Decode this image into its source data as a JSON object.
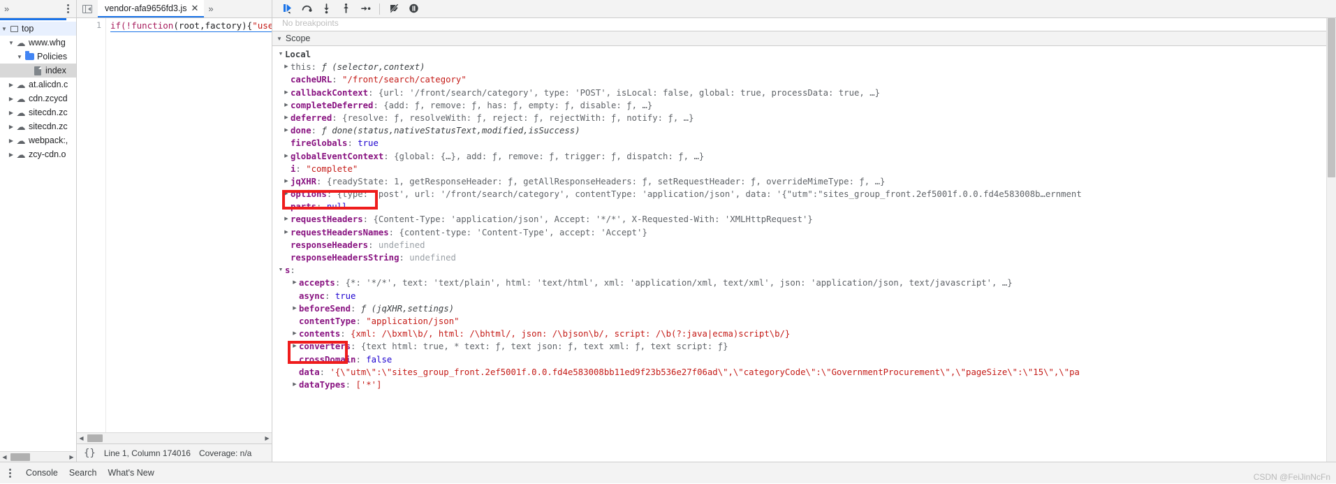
{
  "navigator": {
    "overflow_icon": "chevron-double-right",
    "menu_icon": "kebab-menu",
    "tree": [
      {
        "label": "top",
        "icon": "frame-icon",
        "twisty": "open",
        "indent": 0,
        "state": "highlight"
      },
      {
        "label": "www.whg",
        "icon": "cloud-icon",
        "twisty": "open",
        "indent": 1,
        "state": "normal"
      },
      {
        "label": "Policies",
        "icon": "folder-icon",
        "twisty": "open",
        "indent": 2,
        "state": "normal"
      },
      {
        "label": "index",
        "icon": "file-icon",
        "twisty": "blank",
        "indent": 3,
        "state": "selected"
      },
      {
        "label": "at.alicdn.c",
        "icon": "cloud-icon",
        "twisty": "closed",
        "indent": 1,
        "state": "normal"
      },
      {
        "label": "cdn.zcycd",
        "icon": "cloud-icon",
        "twisty": "closed",
        "indent": 1,
        "state": "normal"
      },
      {
        "label": "sitecdn.zc",
        "icon": "cloud-icon",
        "twisty": "closed",
        "indent": 1,
        "state": "normal"
      },
      {
        "label": "sitecdn.zc",
        "icon": "cloud-icon",
        "twisty": "closed",
        "indent": 1,
        "state": "normal"
      },
      {
        "label": "webpack:,",
        "icon": "cloud-icon",
        "twisty": "closed",
        "indent": 1,
        "state": "normal"
      },
      {
        "label": "zcy-cdn.o",
        "icon": "cloud-icon",
        "twisty": "closed",
        "indent": 1,
        "state": "normal"
      }
    ]
  },
  "editor": {
    "panel_toggle_icon": "show-navigator-icon",
    "tab_label": "vendor-afa9656fd3.js",
    "tab_close_icon": "close-icon",
    "tabs_overflow_icon": "chevron-double-right",
    "gutter_line": "1",
    "code": {
      "seg1": "if(!",
      "seg2": "function",
      "seg3": "(root,factory){",
      "seg4": "\"use"
    },
    "status": {
      "pretty_print_icon": "{}",
      "position": "Line 1, Column 174016",
      "coverage": "Coverage: n/a"
    }
  },
  "debugger": {
    "buttons": [
      {
        "name": "resume-script-execution",
        "icon": "resume-icon"
      },
      {
        "name": "step-over-next-function-call",
        "icon": "step-over-icon"
      },
      {
        "name": "step-into-next-function-call",
        "icon": "step-into-icon"
      },
      {
        "name": "step-out-of-current-function",
        "icon": "step-out-icon"
      },
      {
        "name": "step",
        "icon": "step-icon"
      },
      {
        "name": "deactivate-breakpoints",
        "icon": "deactivate-breakpoints-icon"
      },
      {
        "name": "pause-on-exceptions",
        "icon": "pause-on-exceptions-icon"
      }
    ],
    "ghost_text": "No breakpoints",
    "scope_header": "Scope",
    "scope_name": "Local",
    "rows": [
      {
        "id": "r-local",
        "indent": 0,
        "twisty": "open",
        "key": "Local",
        "key_style": "scope",
        "value": ""
      },
      {
        "id": "r-this",
        "indent": 1,
        "twisty": "closed",
        "key": "this",
        "key_style": "plain",
        "value_html": "fn:ƒ (selector,context)"
      },
      {
        "id": "r-cacheurl",
        "indent": 1,
        "twisty": "none",
        "key": "cacheURL",
        "key_style": "bold",
        "value_html": "str:\"/front/search/category\""
      },
      {
        "id": "r-callbackcontext",
        "indent": 1,
        "twisty": "closed",
        "key": "callbackContext",
        "key_style": "bold",
        "value_html": "obj"
      },
      {
        "id": "r-completedeferred",
        "indent": 1,
        "twisty": "closed",
        "key": "completeDeferred",
        "key_style": "bold",
        "value_html": "obj"
      },
      {
        "id": "r-deferred",
        "indent": 1,
        "twisty": "closed",
        "key": "deferred",
        "key_style": "bold",
        "value_html": "obj"
      },
      {
        "id": "r-done",
        "indent": 1,
        "twisty": "closed",
        "key": "done",
        "key_style": "bold",
        "value_html": "fn"
      },
      {
        "id": "r-fireglobals",
        "indent": 1,
        "twisty": "none",
        "key": "fireGlobals",
        "key_style": "bold",
        "value_html": "bool"
      },
      {
        "id": "r-globaleventcontext",
        "indent": 1,
        "twisty": "closed",
        "key": "globalEventContext",
        "key_style": "bold",
        "value_html": "obj"
      },
      {
        "id": "r-i",
        "indent": 1,
        "twisty": "none",
        "key": "i",
        "key_style": "bold",
        "value_html": "str"
      },
      {
        "id": "r-jqxhr",
        "indent": 1,
        "twisty": "closed",
        "key": "jqXHR",
        "key_style": "bold",
        "value_html": "obj"
      },
      {
        "id": "r-options",
        "indent": 1,
        "twisty": "closed",
        "key": "options",
        "key_style": "bold",
        "value_html": "obj"
      },
      {
        "id": "r-parts",
        "indent": 1,
        "twisty": "none",
        "key": "parts",
        "key_style": "bold",
        "value_html": "null"
      },
      {
        "id": "r-requestheaders",
        "indent": 1,
        "twisty": "closed",
        "key": "requestHeaders",
        "key_style": "bold",
        "value_html": "obj"
      },
      {
        "id": "r-requestheadersnames",
        "indent": 1,
        "twisty": "closed",
        "key": "requestHeadersNames",
        "key_style": "bold",
        "value_html": "obj"
      },
      {
        "id": "r-responseheaders",
        "indent": 1,
        "twisty": "none",
        "key": "responseHeaders",
        "key_style": "bold",
        "value_html": "undefined"
      },
      {
        "id": "r-responseheadersstring",
        "indent": 1,
        "twisty": "none",
        "key": "responseHeadersString",
        "key_style": "bold",
        "value_html": "undefined"
      },
      {
        "id": "r-s",
        "indent": 1,
        "twisty": "open",
        "key": "s",
        "key_style": "bold",
        "value_html": ""
      },
      {
        "id": "r-accepts",
        "indent": 2,
        "twisty": "closed",
        "key": "accepts",
        "key_style": "bold",
        "value_html": "obj"
      },
      {
        "id": "r-async",
        "indent": 2,
        "twisty": "none",
        "key": "async",
        "key_style": "bold",
        "value_html": "bool"
      },
      {
        "id": "r-beforesend",
        "indent": 2,
        "twisty": "closed",
        "key": "beforeSend",
        "key_style": "bold",
        "value_html": "fn"
      },
      {
        "id": "r-contenttype",
        "indent": 2,
        "twisty": "none",
        "key": "contentType",
        "key_style": "bold",
        "value_html": "str"
      },
      {
        "id": "r-contents",
        "indent": 2,
        "twisty": "closed",
        "key": "contents",
        "key_style": "bold",
        "value_html": "obj"
      },
      {
        "id": "r-converters",
        "indent": 2,
        "twisty": "closed",
        "key": "converters",
        "key_style": "bold",
        "value_html": "obj"
      },
      {
        "id": "r-crossdomain",
        "indent": 2,
        "twisty": "none",
        "key": "crossDomain",
        "key_style": "bold",
        "value_html": "bool"
      },
      {
        "id": "r-data",
        "indent": 2,
        "twisty": "none",
        "key": "data",
        "key_style": "bold",
        "value_html": "str"
      },
      {
        "id": "r-datatypes",
        "indent": 2,
        "twisty": "closed",
        "key": "dataTypes",
        "key_style": "bold",
        "value_html": "arr"
      }
    ],
    "text": {
      "local": "Local",
      "this_key": "this",
      "this_val": "ƒ (selector,context)",
      "cacheurl_key": "cacheURL",
      "cacheurl_val": "\"/front/search/category\"",
      "callbackcontext_key": "callbackContext",
      "callbackcontext_val": "{url: '/front/search/category', type: 'POST', isLocal: false, global: true, processData: true, …}",
      "completedeferred_key": "completeDeferred",
      "completedeferred_val": "{add: ƒ, remove: ƒ, has: ƒ, empty: ƒ, disable: ƒ, …}",
      "deferred_key": "deferred",
      "deferred_val": "{resolve: ƒ, resolveWith: ƒ, reject: ƒ, rejectWith: ƒ, notify: ƒ, …}",
      "done_key": "done",
      "done_val": "ƒ done(status,nativeStatusText,modified,isSuccess)",
      "fireglobals_key": "fireGlobals",
      "fireglobals_val": "true",
      "globaleventcontext_key": "globalEventContext",
      "globaleventcontext_val": "{global: {…}, add: ƒ, remove: ƒ, trigger: ƒ, dispatch: ƒ, …}",
      "i_key": "i",
      "i_val": "\"complete\"",
      "jqxhr_key": "jqXHR",
      "jqxhr_val": "{readyState: 1, getResponseHeader: ƒ, getAllResponseHeaders: ƒ, setRequestHeader: ƒ, overrideMimeType: ƒ, …}",
      "options_key": "options",
      "options_val": "{type: 'post', url: '/front/search/category', contentType: 'application/json', data: '{\"utm\":\"sites_group_front.2ef5001f.0.0.fd4e583008b…ernment",
      "parts_key": "parts",
      "parts_val": "null",
      "requestheaders_key": "requestHeaders",
      "requestheaders_val": "{Content-Type: 'application/json', Accept: '*/*', X-Requested-With: 'XMLHttpRequest'}",
      "requestheadersnames_key": "requestHeadersNames",
      "requestheadersnames_val": "{content-type: 'Content-Type', accept: 'Accept'}",
      "responseheaders_key": "responseHeaders",
      "responseheaders_val": "undefined",
      "responseheadersstring_key": "responseHeadersString",
      "responseheadersstring_val": "undefined",
      "s_key": "s",
      "accepts_key": "accepts",
      "accepts_val": "{*: '*/*', text: 'text/plain', html: 'text/html', xml: 'application/xml, text/xml', json: 'application/json, text/javascript', …}",
      "async_key": "async",
      "async_val": "true",
      "beforesend_key": "beforeSend",
      "beforesend_val": "ƒ (jqXHR,settings)",
      "contenttype_key": "contentType",
      "contenttype_val": "\"application/json\"",
      "contents_key": "contents",
      "contents_val": "{xml: /\\bxml\\b/, html: /\\bhtml/, json: /\\bjson\\b/, script: /\\b(?:java|ecma)script\\b/}",
      "converters_key": "converters",
      "converters_val": "{text html: true, * text: ƒ, text json: ƒ, text xml: ƒ, text script: ƒ}",
      "crossdomain_key": "crossDomain",
      "crossdomain_val": "false",
      "data_key": "data",
      "data_val": "'{\\\"utm\\\":\\\"sites_group_front.2ef5001f.0.0.fd4e583008bb11ed9f23b536e27f06ad\\\",\\\"categoryCode\\\":\\\"GovernmentProcurement\\\",\\\"pageSize\\\":\\\"15\\\",\\\"pa",
      "datatypes_key": "dataTypes",
      "datatypes_val": "['*']"
    }
  },
  "drawer": {
    "menu_icon": "kebab-menu",
    "tabs": [
      "Console",
      "Search",
      "What's New"
    ]
  },
  "watermark": "CSDN @FeiJinNcFn",
  "colors": {
    "accent": "#1a73e8",
    "annotation": "#ef1c1c",
    "key": "#881280",
    "string": "#c41a16",
    "number": "#1c00cf"
  }
}
